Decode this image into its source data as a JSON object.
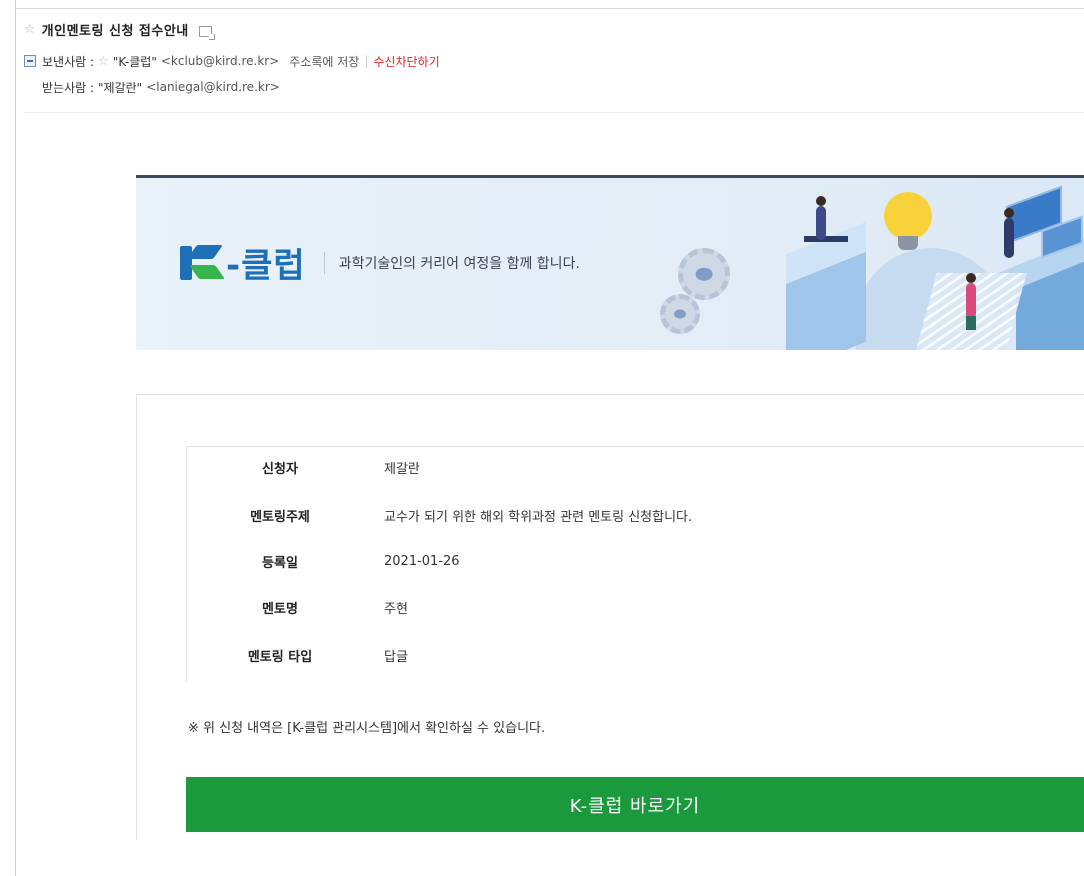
{
  "email": {
    "subject": "개인멘토링 신청 접수안내",
    "from_label": "보낸사람 :",
    "from_name": "\"K-클럽\"",
    "from_addr": "<kclub@kird.re.kr>",
    "save_contact": "주소록에 저장",
    "separator": "|",
    "block_label": "수신차단하기",
    "to_label": "받는사람 :",
    "to_name": "\"제갈란\"",
    "to_addr": "<laniegal@kird.re.kr>"
  },
  "banner": {
    "logo_dash": "-",
    "logo_text": "클럽",
    "tagline": "과학기술인의 커리어 여정을 함께 합니다."
  },
  "details": [
    {
      "label": "신청자",
      "value": "제갈란"
    },
    {
      "label": "멘토링주제",
      "value": "교수가 되기 위한 해외 학위과정 관련 멘토링 신청합니다."
    },
    {
      "label": "등록일",
      "value": "2021-01-26"
    },
    {
      "label": "멘토명",
      "value": "주현"
    },
    {
      "label": "멘토링 타입",
      "value": "답글"
    }
  ],
  "notice": "※ 위 신청 내역은 [K-클럽 관리시스템]에서 확인하실 수 있습니다.",
  "cta_label": "K-클럽 바로가기",
  "colors": {
    "cta": "#1a9a3c",
    "brand_blue": "#1d6fb8",
    "brand_green": "#36b54a",
    "block_red": "#e0232b"
  },
  "icons": [
    "star-icon",
    "popout-icon",
    "collapse-icon"
  ]
}
